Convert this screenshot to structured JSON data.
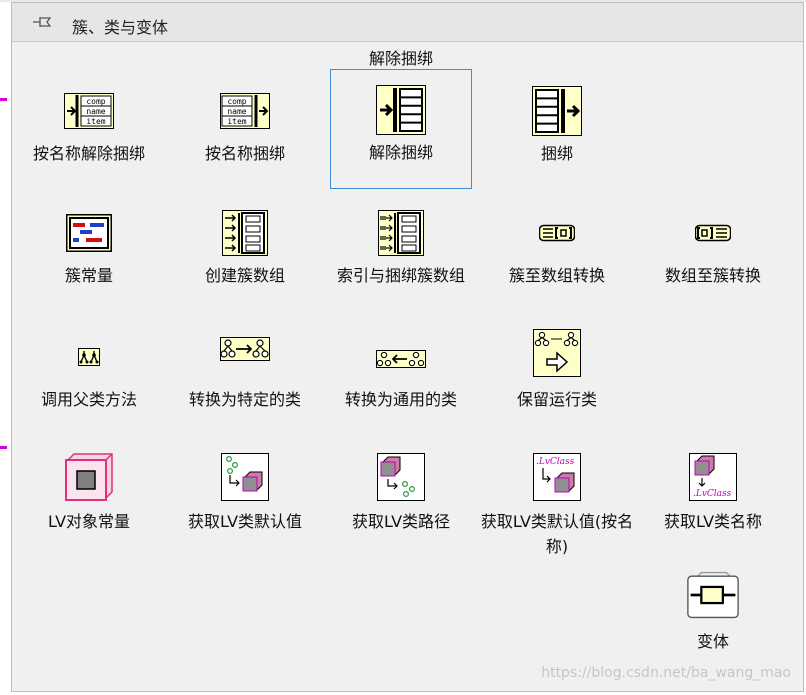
{
  "palette": {
    "title": "簇、类与变体",
    "selected_tooltip": "解除捆绑",
    "items": [
      {
        "label": "按名称解除捆绑",
        "icon": "unbundle-by-name-icon"
      },
      {
        "label": "按名称捆绑",
        "icon": "bundle-by-name-icon"
      },
      {
        "label": "解除捆绑",
        "icon": "unbundle-icon"
      },
      {
        "label": "捆绑",
        "icon": "bundle-icon"
      },
      {
        "label": "簇常量",
        "icon": "cluster-constant-icon"
      },
      {
        "label": "创建簇数组",
        "icon": "build-cluster-array-icon"
      },
      {
        "label": "索引与捆绑簇数组",
        "icon": "index-bundle-cluster-array-icon"
      },
      {
        "label": "簇至数组转换",
        "icon": "cluster-to-array-icon"
      },
      {
        "label": "数组至簇转换",
        "icon": "array-to-cluster-icon"
      },
      {
        "label": "调用父类方法",
        "icon": "call-parent-method-icon"
      },
      {
        "label": "转换为特定的类",
        "icon": "to-more-specific-class-icon"
      },
      {
        "label": "转换为通用的类",
        "icon": "to-more-generic-class-icon"
      },
      {
        "label": "保留运行类",
        "icon": "preserve-runtime-class-icon"
      },
      {
        "label": "LV对象常量",
        "icon": "lv-object-constant-icon"
      },
      {
        "label": "获取LV类默认值",
        "icon": "get-lv-class-default-value-icon"
      },
      {
        "label": "获取LV类路径",
        "icon": "get-lv-class-path-icon"
      },
      {
        "label": "获取LV类默认值(按名称)",
        "icon": "get-lv-class-default-value-by-name-icon"
      },
      {
        "label": "获取LV类名称",
        "icon": "get-lv-class-name-icon"
      },
      {
        "label": "变体",
        "icon": "variant-icon"
      }
    ],
    "icon_text": {
      "comp": "comp",
      "name": "name",
      "item": "item",
      "lvclass": ".LvClass"
    }
  },
  "watermark": "https://blog.csdn.net/ba_wang_mao",
  "colors": {
    "icon_fill": "#ffffc8",
    "selection_border": "#3a8fd6",
    "lv_object_pink": "#e0307a",
    "lv_class_magenta": "#c000c0"
  }
}
